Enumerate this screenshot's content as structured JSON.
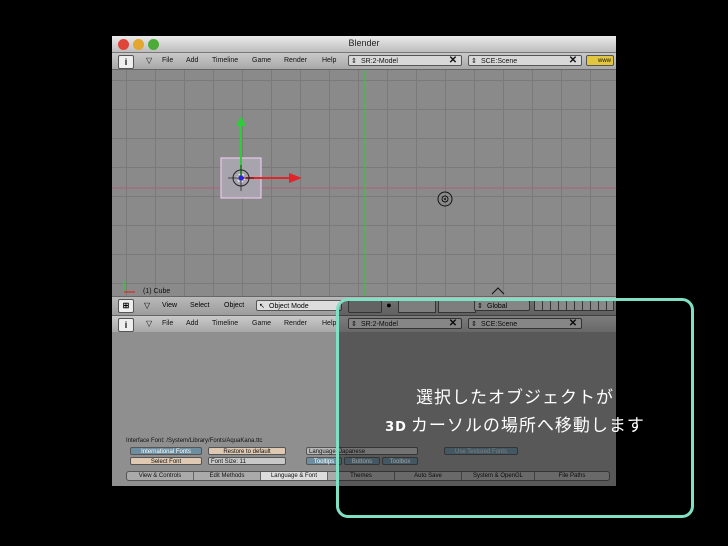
{
  "window": {
    "title": "Blender"
  },
  "topmenu": {
    "items": [
      "File",
      "Add",
      "Timeline",
      "Game",
      "Render",
      "Help"
    ],
    "screen_field": "SR:2-Model",
    "scene_field": "SCE:Scene",
    "logo": "www"
  },
  "viewport": {
    "object_label": "(1) Cube"
  },
  "view3d_header": {
    "view": "View",
    "select": "Select",
    "object": "Object",
    "mode": "Object Mode",
    "orientation": "Global"
  },
  "bottommenu": {
    "items": [
      "File",
      "Add",
      "Timeline",
      "Game",
      "Render",
      "Help"
    ],
    "screen_field": "SR:2-Model",
    "scene_field": "SCE:Scene"
  },
  "prefs": {
    "interface_font_label": "Interface Font: /System/Library/Fonts/AquaKana.ttc",
    "intl_fonts": "International Fonts",
    "restore_default": "Restore to default",
    "language": "Language: Japanese",
    "use_textured_fonts": "Use Textured Fonts",
    "select_font": "Select Font",
    "font_size": "Font Size: 11",
    "tooltips": "Tooltips",
    "buttons": "Buttons",
    "toolbox": "Toolbox",
    "tabs": [
      "View & Controls",
      "Edit Methods",
      "Language & Font",
      "Themes",
      "Auto Save",
      "System & OpenGL",
      "File Paths"
    ]
  },
  "overlay": {
    "line1": "選択したオブジェクトが",
    "prefix": "3D",
    "line2": "カーソルの場所へ移動します"
  },
  "colors": {
    "overlay_border": "#7fe0c4",
    "x_axis": "#e0242a",
    "y_axis": "#2ecc3a"
  }
}
